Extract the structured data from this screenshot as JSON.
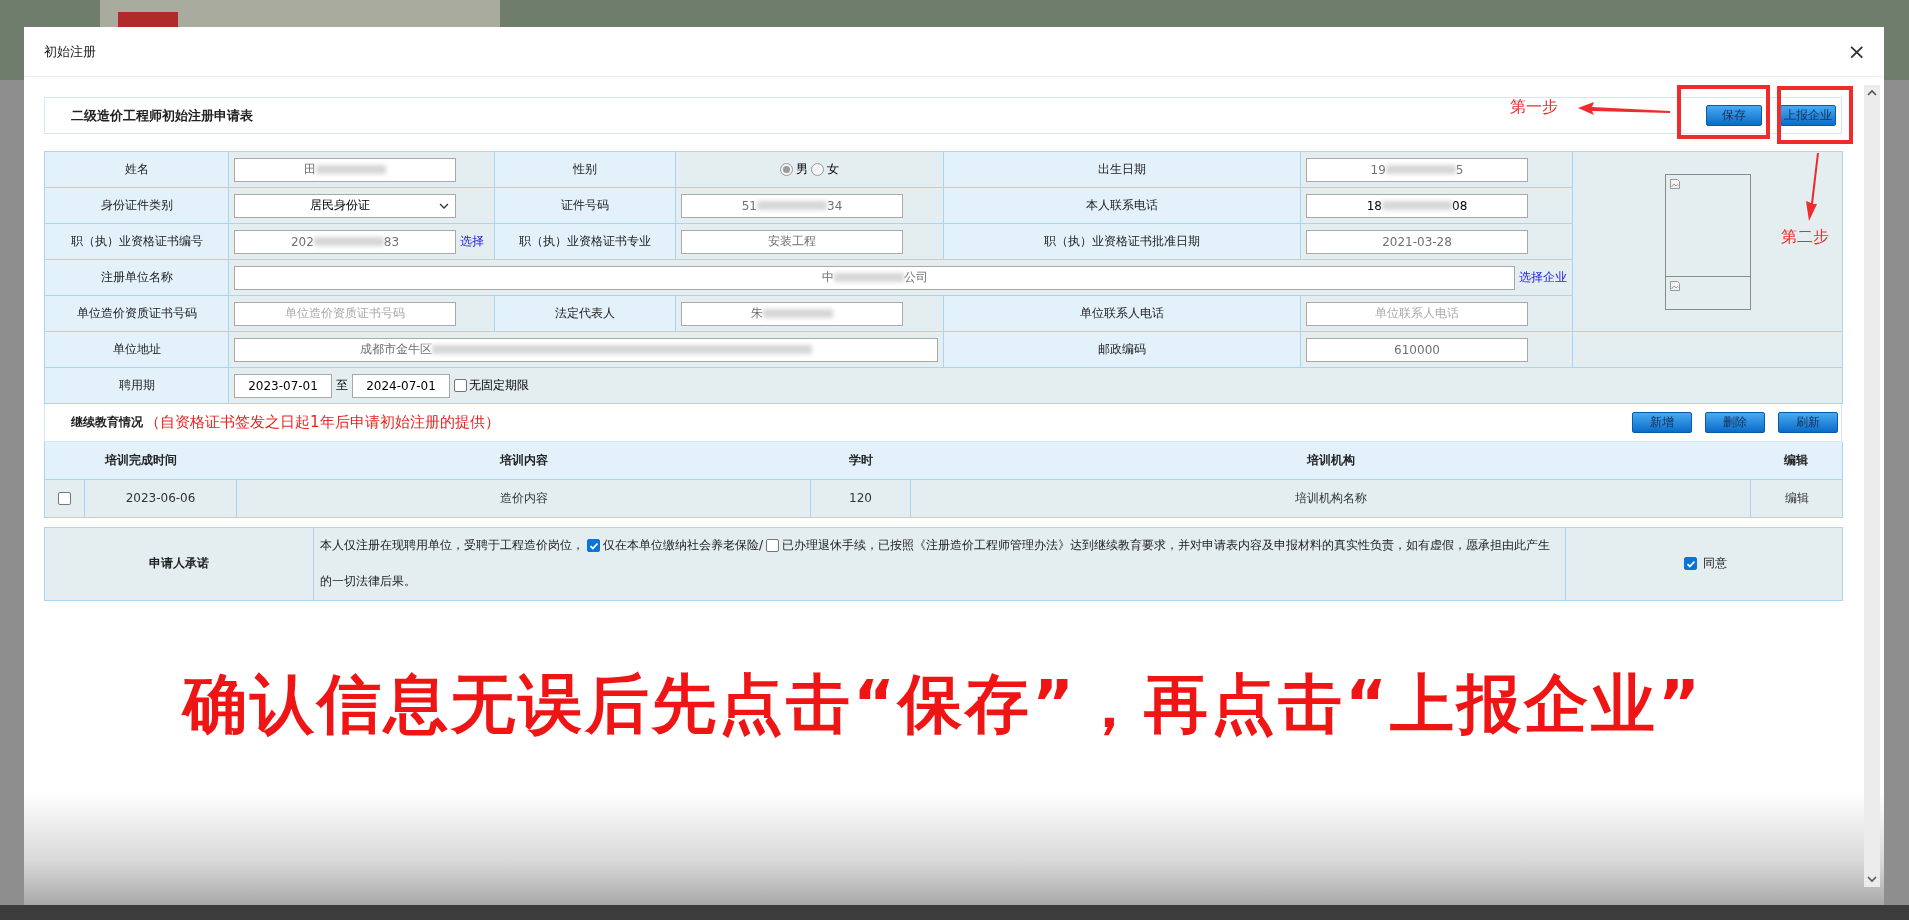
{
  "dialog": {
    "title": "初始注册",
    "close": "×"
  },
  "form_title": "二级造价工程师初始注册申请表",
  "toolbar": [
    {
      "label": "保存"
    },
    {
      "label": "上报企业"
    }
  ],
  "info": {
    "rows": [
      {
        "cells": [
          {
            "kind": "label",
            "text": "姓名"
          },
          {
            "kind": "value",
            "items": [
              {
                "kind": "input",
                "value": "田",
                "redacted": true,
                "readonly": true
              }
            ]
          },
          {
            "kind": "label",
            "text": "性别"
          },
          {
            "kind": "value",
            "items": [
              {
                "kind": "radio",
                "options": [
                  {
                    "label": "男",
                    "selected": true
                  },
                  {
                    "label": "女",
                    "selected": false
                  }
                ]
              }
            ]
          },
          {
            "kind": "label",
            "text": "出生日期"
          },
          {
            "kind": "value",
            "items": [
              {
                "kind": "input",
                "value": "19",
                "value_end": "5",
                "redacted": true,
                "readonly": true
              }
            ]
          }
        ]
      },
      {
        "cells": [
          {
            "kind": "label",
            "text": "身份证件类别"
          },
          {
            "kind": "value",
            "items": [
              {
                "kind": "select",
                "value": "居民身份证"
              }
            ]
          },
          {
            "kind": "label",
            "text": "证件号码"
          },
          {
            "kind": "value",
            "items": [
              {
                "kind": "input",
                "value": "51",
                "value_end": "34",
                "redacted": true,
                "readonly": true
              }
            ]
          },
          {
            "kind": "label",
            "text": "本人联系电话"
          },
          {
            "kind": "value",
            "items": [
              {
                "kind": "input",
                "value": "18",
                "value_end": "08",
                "redacted": true,
                "readonly": false
              }
            ]
          }
        ]
      },
      {
        "cells": [
          {
            "kind": "label",
            "text": "职（执）业资格证书编号"
          },
          {
            "kind": "value",
            "items": [
              {
                "kind": "input",
                "value": "202",
                "value_end": "83",
                "redacted": true,
                "readonly": true
              },
              {
                "kind": "link",
                "text": "选择"
              }
            ]
          },
          {
            "kind": "label",
            "text": "职（执）业资格证书专业"
          },
          {
            "kind": "value",
            "items": [
              {
                "kind": "input",
                "value": "安装工程",
                "readonly": true
              }
            ]
          },
          {
            "kind": "label",
            "text": "职（执）业资格证书批准日期"
          },
          {
            "kind": "value",
            "items": [
              {
                "kind": "input",
                "value": "2021-03-28",
                "readonly": true
              }
            ]
          }
        ]
      },
      {
        "cells": [
          {
            "kind": "label",
            "text": "注册单位名称"
          },
          {
            "kind": "value",
            "colspan": 5,
            "items": [
              {
                "kind": "input",
                "value": "中",
                "value_end": "公司",
                "redacted": true,
                "readonly": true
              },
              {
                "kind": "link",
                "text": "选择企业"
              }
            ]
          }
        ]
      },
      {
        "cells": [
          {
            "kind": "label",
            "text": "单位造价资质证书号码"
          },
          {
            "kind": "value",
            "items": [
              {
                "kind": "input",
                "placeholder": "单位造价资质证书号码"
              }
            ]
          },
          {
            "kind": "label",
            "text": "法定代表人"
          },
          {
            "kind": "value",
            "items": [
              {
                "kind": "input",
                "value": "朱",
                "redacted": true,
                "readonly": true
              }
            ]
          },
          {
            "kind": "label",
            "text": "单位联系人电话"
          },
          {
            "kind": "value",
            "items": [
              {
                "kind": "input",
                "placeholder": "单位联系人电话"
              }
            ]
          }
        ]
      },
      {
        "cells": [
          {
            "kind": "label",
            "text": "单位地址"
          },
          {
            "kind": "value",
            "colspan": 3,
            "items": [
              {
                "kind": "input",
                "value": "成都市金牛区",
                "redacted": true,
                "readonly": true
              }
            ]
          },
          {
            "kind": "label",
            "text": "邮政编码"
          },
          {
            "kind": "value",
            "items": [
              {
                "kind": "input",
                "value": "610000",
                "readonly": true
              }
            ]
          }
        ]
      },
      {
        "cells": [
          {
            "kind": "label",
            "text": "聘用期"
          },
          {
            "kind": "value",
            "colspan": 6,
            "items": [
              {
                "kind": "date",
                "value": "2023-07-01"
              },
              {
                "kind": "text",
                "text": "至"
              },
              {
                "kind": "date",
                "value": "2024-07-01"
              },
              {
                "kind": "checkbox",
                "label": "无固定期限",
                "checked": false
              }
            ]
          }
        ]
      }
    ]
  },
  "education": {
    "title": "继续教育情况",
    "note": "（自资格证书签发之日起1年后申请初始注册的提供）",
    "buttons": [
      {
        "label": "新增"
      },
      {
        "label": "删除"
      },
      {
        "label": "刷新"
      }
    ],
    "columns": [
      "培训完成时间",
      "培训内容",
      "学时",
      "培训机构",
      "编辑"
    ],
    "rows": [
      {
        "selected": false,
        "cells": [
          "2023-06-06",
          "造价内容",
          "120",
          "培训机构名称",
          "编辑"
        ]
      }
    ]
  },
  "promise": {
    "label": "申请人承诺",
    "lines": [
      [
        {
          "kind": "text",
          "text": "本人仅注册在现聘用单位，受聘于工程造价岗位，"
        },
        {
          "kind": "checkbox",
          "checked": true
        },
        {
          "kind": "text",
          "text": "仅在本单位缴纳社会养老保险/"
        },
        {
          "kind": "checkbox",
          "checked": false
        },
        {
          "kind": "text",
          "text": "已办理退休手续，已按照《注册造价工程师管理办法》达到继续教育要求，并对申请表内容及申报材料的真实性负责，如有虚假，愿承担由此产生"
        }
      ],
      [
        {
          "kind": "text",
          "text": "的一切法律后果。"
        }
      ]
    ],
    "agree": {
      "label": "同意",
      "checked": true
    }
  },
  "caption": "确认信息无误后先点击“保存”，再点击“上报企业”",
  "annotations": [
    {
      "text": "第一步"
    },
    {
      "text": "第二步"
    }
  ]
}
